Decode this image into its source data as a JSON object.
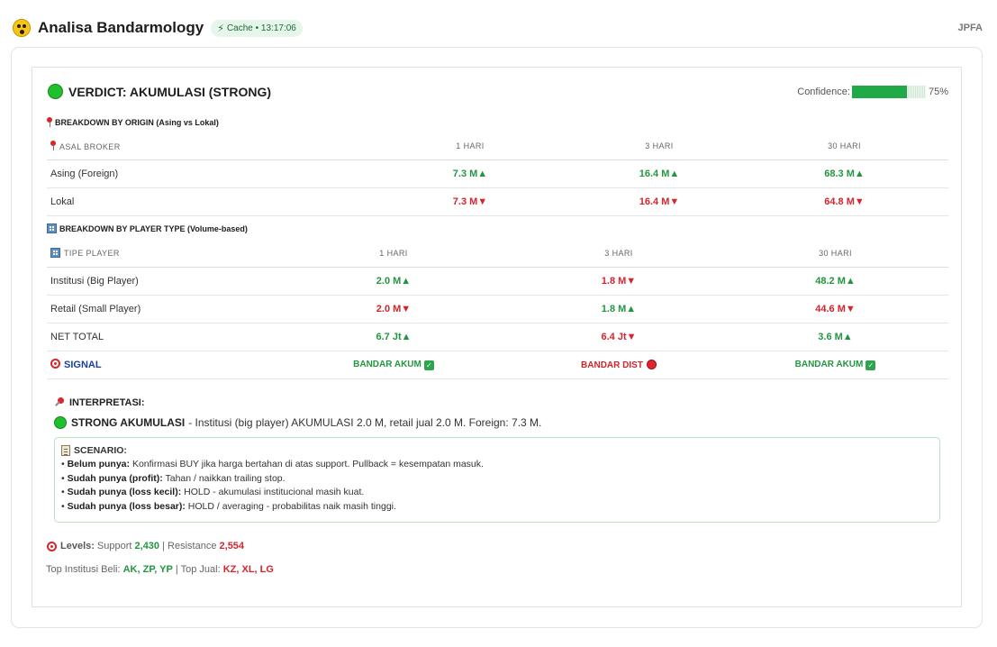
{
  "header": {
    "title": "Analisa Bandarmology",
    "cache_label": "Cache • 13:17:06",
    "ticker": "JPFA"
  },
  "verdict": {
    "text": "VERDICT: AKUMULASI (STRONG)",
    "confidence_label": "Confidence:",
    "confidence_value": "75%",
    "confidence_fraction": 0.75,
    "accent": "#1fbf2d"
  },
  "origin": {
    "title": "BREAKDOWN BY ORIGIN (Asing vs Lokal)",
    "headers": [
      "ASAL BROKER",
      "1 HARI",
      "3 HARI",
      "30 HARI"
    ],
    "rows": [
      {
        "label": "Asing (Foreign)",
        "cells": [
          {
            "v": "7.3 M▲",
            "dir": "up"
          },
          {
            "v": "16.4 M▲",
            "dir": "up"
          },
          {
            "v": "68.3 M▲",
            "dir": "up"
          }
        ]
      },
      {
        "label": "Lokal",
        "cells": [
          {
            "v": "7.3 M▼",
            "dir": "down"
          },
          {
            "v": "16.4 M▼",
            "dir": "down"
          },
          {
            "v": "64.8 M▼",
            "dir": "down"
          }
        ]
      }
    ]
  },
  "player": {
    "title": "BREAKDOWN BY PLAYER TYPE (Volume-based)",
    "headers": [
      "TIPE PLAYER",
      "1 HARI",
      "3 HARI",
      "30 HARI"
    ],
    "rows": [
      {
        "label": "Institusi (Big Player)",
        "cells": [
          {
            "v": "2.0 M▲",
            "dir": "up"
          },
          {
            "v": "1.8 M▼",
            "dir": "down"
          },
          {
            "v": "48.2 M▲",
            "dir": "up"
          }
        ]
      },
      {
        "label": "Retail (Small Player)",
        "cells": [
          {
            "v": "2.0 M▼",
            "dir": "down"
          },
          {
            "v": "1.8 M▲",
            "dir": "up"
          },
          {
            "v": "44.6 M▼",
            "dir": "down"
          }
        ]
      },
      {
        "label": "NET TOTAL",
        "cells": [
          {
            "v": "6.7 Jt▲",
            "dir": "up"
          },
          {
            "v": "6.4 Jt▼",
            "dir": "down"
          },
          {
            "v": "3.6 M▲",
            "dir": "up"
          }
        ]
      }
    ],
    "signal_label": "SIGNAL",
    "signals": [
      "BANDAR AKUM",
      "BANDAR DIST",
      "BANDAR AKUM"
    ]
  },
  "interpretasi": {
    "title": "INTERPRETASI:",
    "strong": "STRONG AKUMULASI",
    "text": "- Institusi (big player) AKUMULASI 2.0 M, retail jual 2.0 M. Foreign: 7.3 M."
  },
  "scenario": {
    "title": "SCENARIO:",
    "items": [
      {
        "k": "Belum punya:",
        "v": "Konfirmasi BUY jika harga bertahan di atas support. Pullback = kesempatan masuk."
      },
      {
        "k": "Sudah punya (profit):",
        "v": "Tahan / naikkan trailing stop."
      },
      {
        "k": "Sudah punya (loss kecil):",
        "v": "HOLD - akumulasi institucional masih kuat."
      },
      {
        "k": "Sudah punya (loss besar):",
        "v": "HOLD / averaging - probabilitas naik masih tinggi."
      }
    ]
  },
  "levels": {
    "label": "Levels:",
    "support_label": "Support",
    "support": "2,430",
    "resistance_label": "Resistance",
    "resistance": "2,554"
  },
  "top": {
    "buy_label": "Top Institusi Beli:",
    "buy": "AK, ZP, YP",
    "sell_label": "Top Jual:",
    "sell": "KZ, XL, LG"
  }
}
